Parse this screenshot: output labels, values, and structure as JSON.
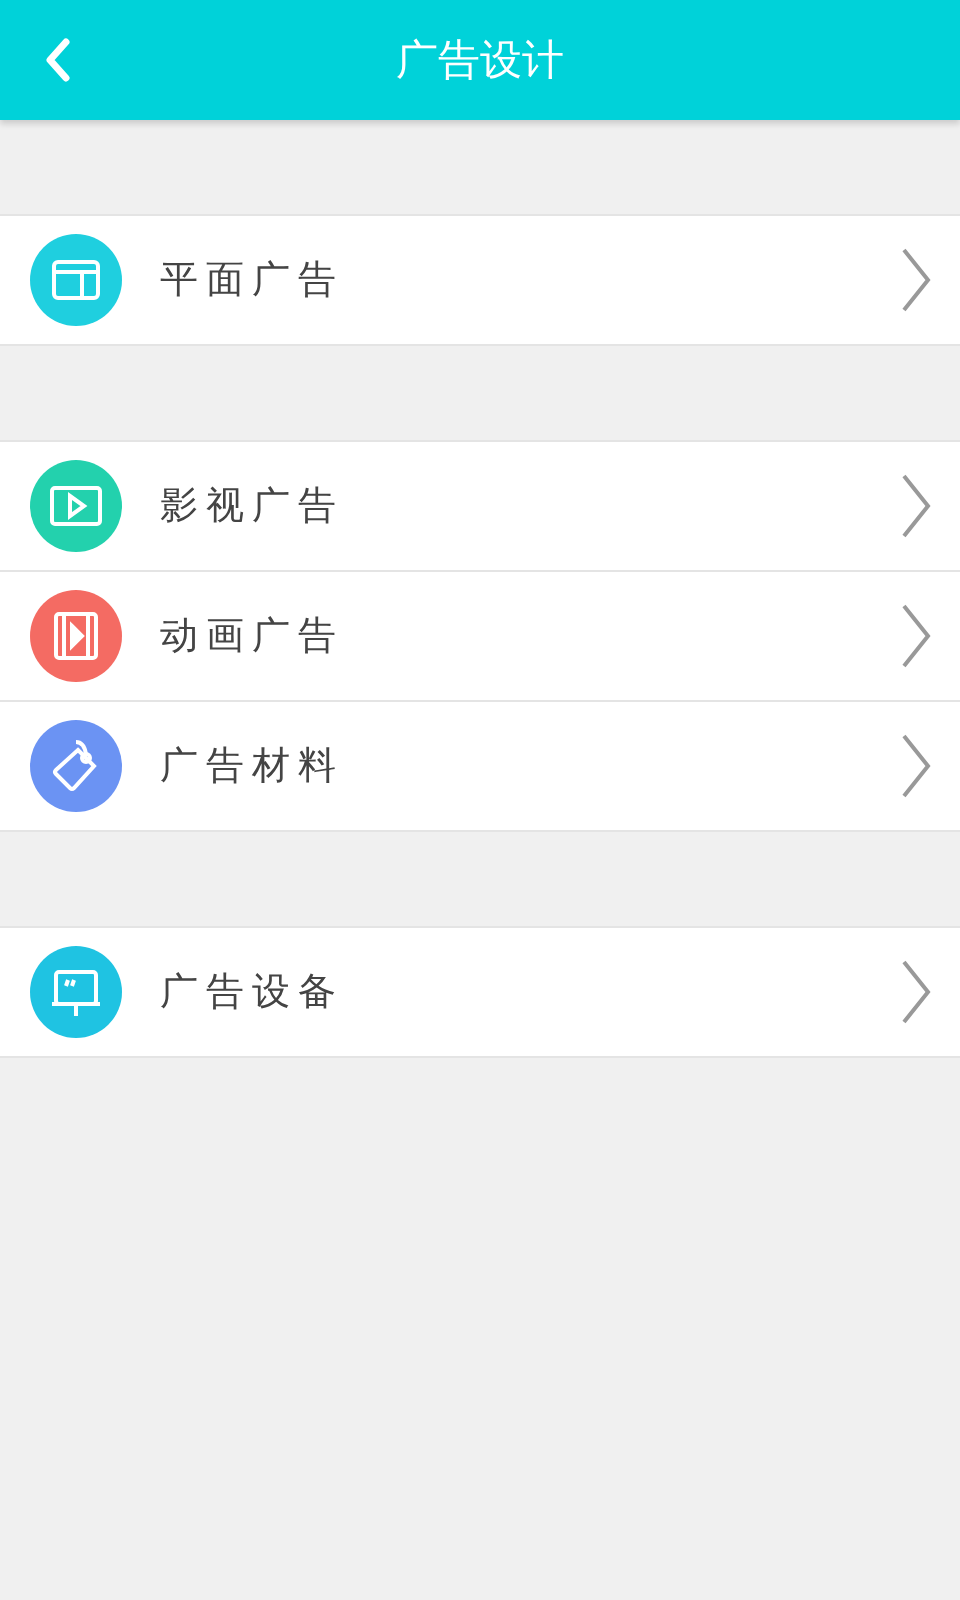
{
  "header": {
    "title": "广告设计"
  },
  "groups": [
    {
      "items": [
        {
          "label": "平面广告",
          "kind": "layout",
          "color": "#1fcfdf"
        }
      ]
    },
    {
      "items": [
        {
          "label": "影视广告",
          "kind": "video",
          "color": "#23d1ad"
        },
        {
          "label": "动画广告",
          "kind": "film",
          "color": "#f46b63"
        },
        {
          "label": "广告材料",
          "kind": "tag",
          "color": "#6b93f3"
        }
      ]
    },
    {
      "items": [
        {
          "label": "广告设备",
          "kind": "display",
          "color": "#1fc3e2"
        }
      ]
    }
  ]
}
